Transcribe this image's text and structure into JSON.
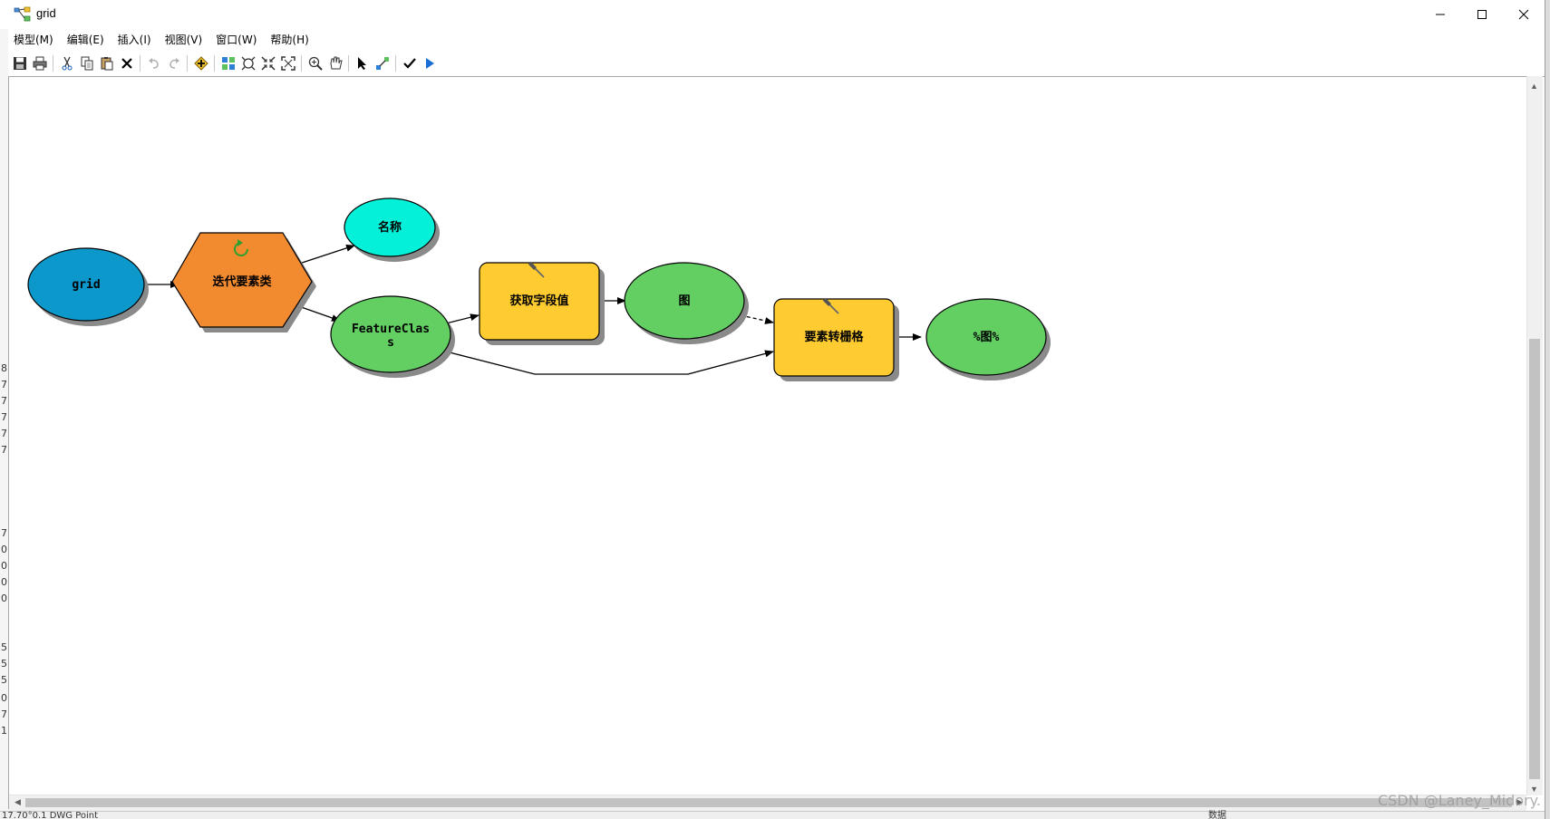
{
  "window": {
    "title": "grid",
    "controls": {
      "minimize": "minimize",
      "maximize": "maximize",
      "close": "close"
    }
  },
  "menubar": {
    "items": [
      {
        "label": "模型(M)"
      },
      {
        "label": "编辑(E)"
      },
      {
        "label": "插入(I)"
      },
      {
        "label": "视图(V)"
      },
      {
        "label": "窗口(W)"
      },
      {
        "label": "帮助(H)"
      }
    ]
  },
  "toolbar": {
    "buttons": [
      "save-icon",
      "print-icon",
      "|",
      "cut-icon",
      "copy-icon",
      "paste-icon",
      "delete-icon",
      "|",
      "undo-icon",
      "redo-icon",
      "|",
      "add-data-icon",
      "|",
      "auto-layout-icon",
      "full-extent-icon",
      "fit-icon",
      "zoom-extent-icon",
      "|",
      "zoom-in-icon",
      "pan-icon",
      "|",
      "select-icon",
      "connect-icon",
      "|",
      "validate-icon",
      "run-icon"
    ]
  },
  "model": {
    "nodes": [
      {
        "id": "grid",
        "label": "grid",
        "shape": "ellipse",
        "color": "#0d98cc"
      },
      {
        "id": "iterate",
        "label": "迭代要素类",
        "shape": "hexagon",
        "color": "#f28a30",
        "badge": "iterate-icon"
      },
      {
        "id": "name",
        "label": "名称",
        "shape": "ellipse",
        "color": "#05f0d8"
      },
      {
        "id": "featureclass",
        "label_lines": [
          "FeatureClas",
          "s"
        ],
        "shape": "ellipse",
        "color": "#63cf63"
      },
      {
        "id": "getfield",
        "label": "获取字段值",
        "shape": "rect",
        "color": "#fecb30",
        "badge": "hammer-icon"
      },
      {
        "id": "tu",
        "label": "图",
        "shape": "ellipse",
        "color": "#63cf63"
      },
      {
        "id": "torast",
        "label": "要素转栅格",
        "shape": "rect",
        "color": "#fecb30",
        "badge": "hammer-icon"
      },
      {
        "id": "out",
        "label": "%图%",
        "shape": "ellipse",
        "color": "#63cf63"
      }
    ],
    "connectors": [
      {
        "from": "grid",
        "to": "iterate",
        "style": "solid"
      },
      {
        "from": "iterate",
        "to": "name",
        "style": "solid"
      },
      {
        "from": "iterate",
        "to": "featureclass",
        "style": "solid"
      },
      {
        "from": "featureclass",
        "to": "getfield",
        "style": "solid"
      },
      {
        "from": "getfield",
        "to": "tu",
        "style": "solid"
      },
      {
        "from": "tu",
        "to": "torast",
        "style": "dashed"
      },
      {
        "from": "featureclass",
        "to": "torast",
        "style": "solid"
      },
      {
        "from": "torast",
        "to": "out",
        "style": "solid"
      }
    ]
  },
  "background": {
    "left_digits": [
      "8",
      "7",
      "7",
      "7",
      "7",
      "7",
      "7",
      "0",
      "0",
      "0",
      "0",
      "5",
      "5",
      "5",
      "0",
      "7",
      "1"
    ],
    "bottom_text": "17.70°0.1    DWG Point",
    "bottom_right_text": "数据"
  },
  "watermark": "CSDN @Laney_Midory."
}
